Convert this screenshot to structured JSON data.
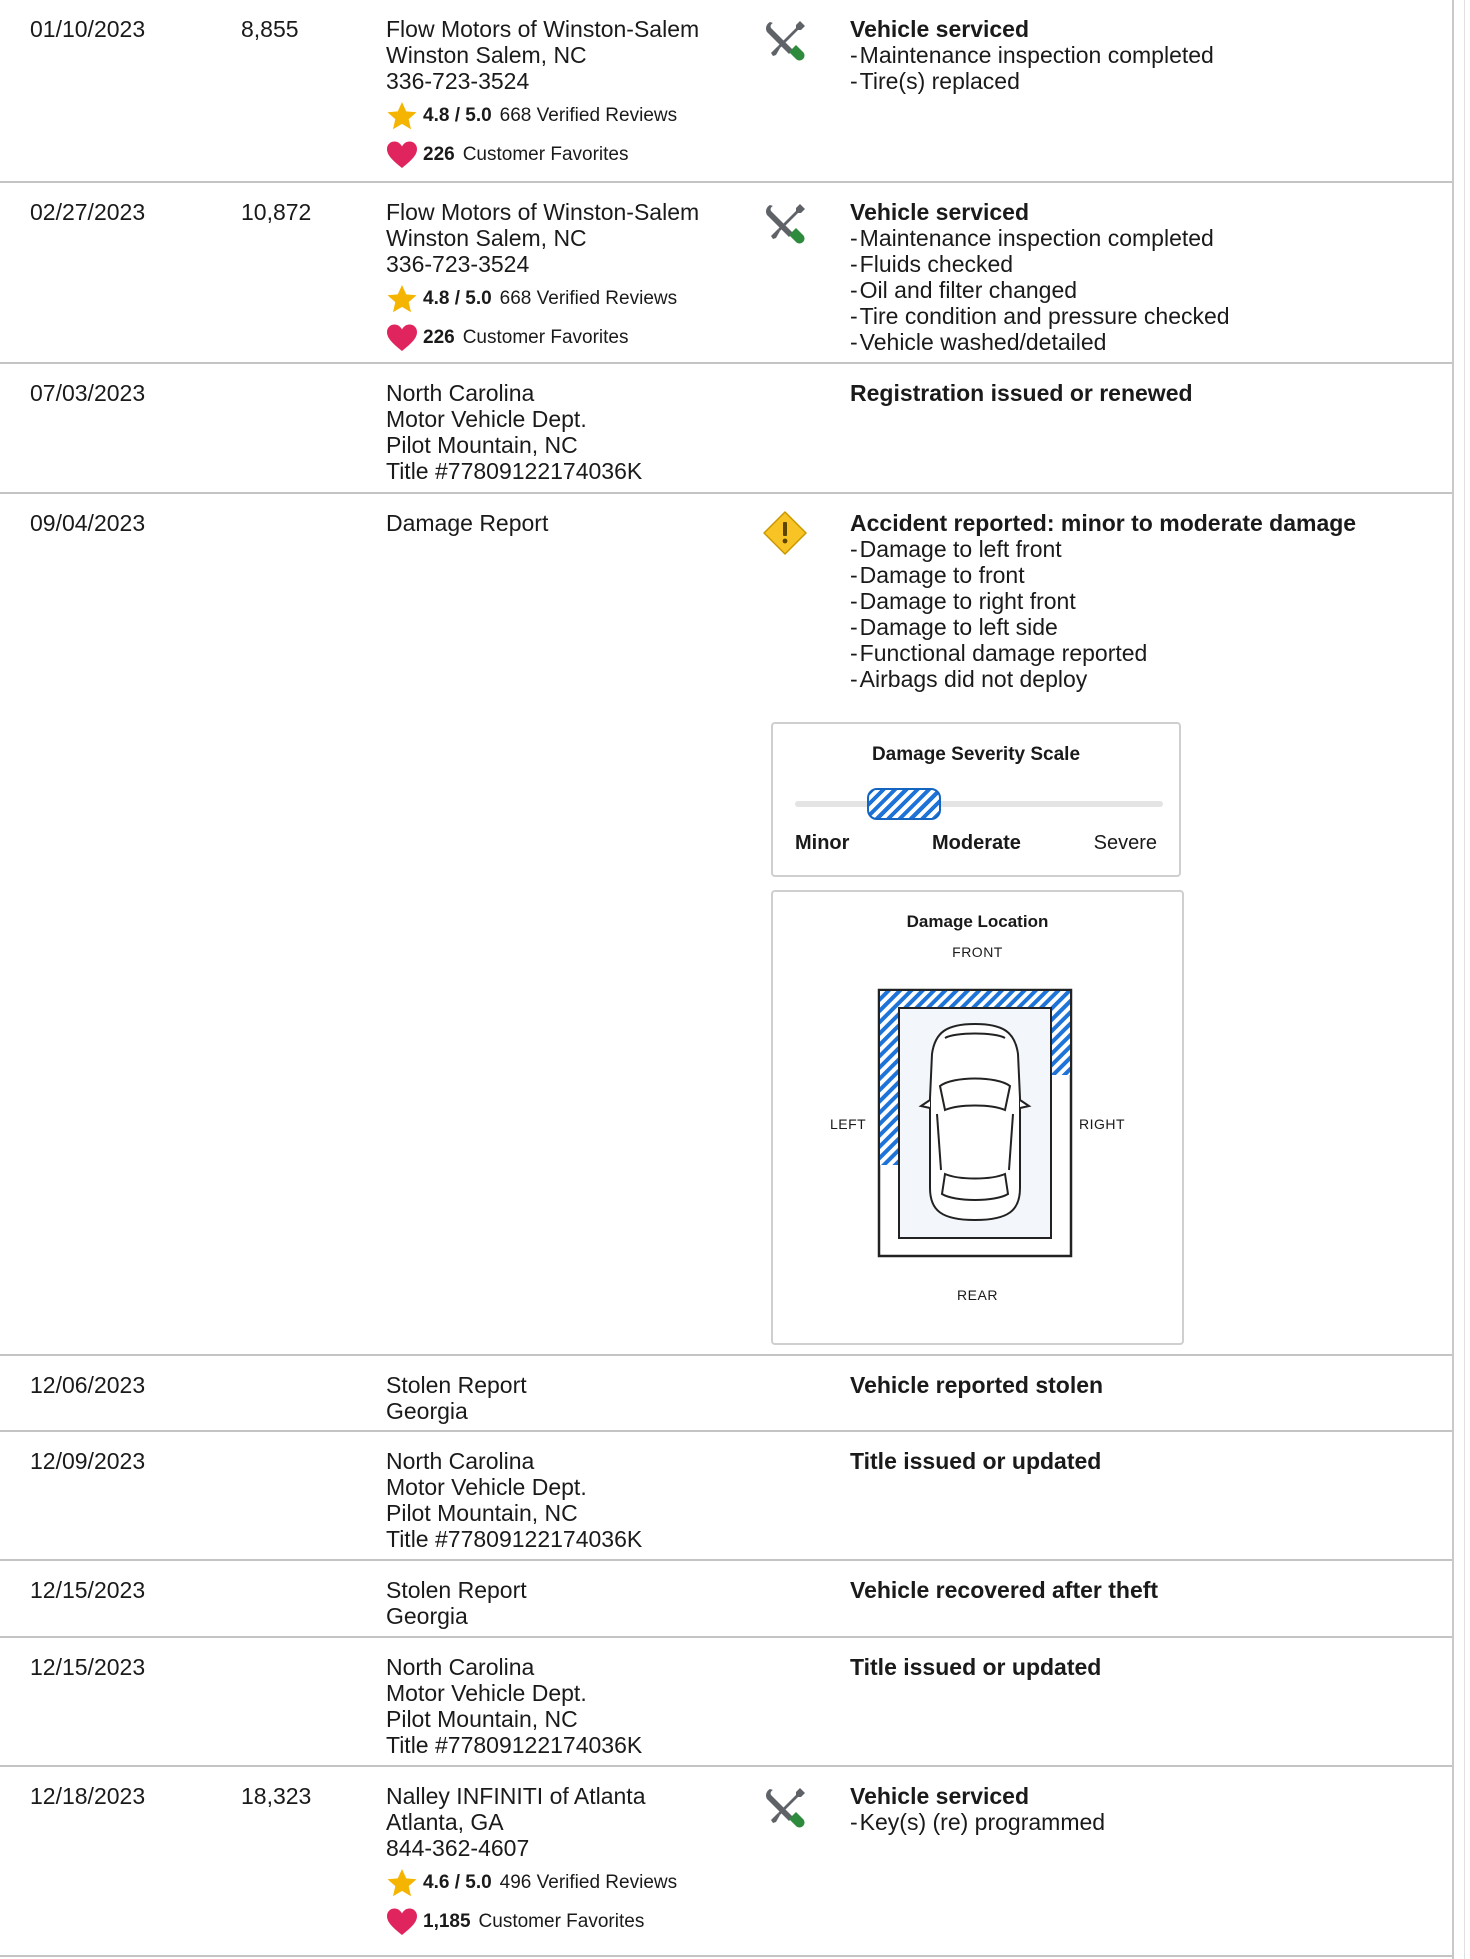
{
  "records": [
    {
      "date": "01/10/2023",
      "odometer": "8,855",
      "source": [
        "Flow Motors of Winston-Salem",
        "Winston Salem, NC",
        "336-723-3524"
      ],
      "rating": {
        "score": "4.8 / 5.0",
        "reviews": "668 Verified Reviews",
        "favorites_count": "226",
        "favorites_label": "Customer Favorites"
      },
      "icon": "wrench-screwdriver-icon",
      "title": "Vehicle serviced",
      "items": [
        "Maintenance inspection completed",
        "Tire(s) replaced"
      ]
    },
    {
      "date": "02/27/2023",
      "odometer": "10,872",
      "source": [
        "Flow Motors of Winston-Salem",
        "Winston Salem, NC",
        "336-723-3524"
      ],
      "rating": {
        "score": "4.8 / 5.0",
        "reviews": "668 Verified Reviews",
        "favorites_count": "226",
        "favorites_label": "Customer Favorites"
      },
      "icon": "wrench-screwdriver-icon",
      "title": "Vehicle serviced",
      "items": [
        "Maintenance inspection completed",
        "Fluids checked",
        "Oil and filter changed",
        "Tire condition and pressure checked",
        "Vehicle washed/detailed"
      ]
    },
    {
      "date": "07/03/2023",
      "odometer": "",
      "source": [
        "North Carolina",
        "Motor Vehicle Dept.",
        "Pilot Mountain, NC",
        "Title #77809122174036K"
      ],
      "icon": "",
      "title": "Registration issued or renewed",
      "items": []
    },
    {
      "date": "09/04/2023",
      "odometer": "",
      "source": [
        "Damage Report"
      ],
      "icon": "warning-diamond-icon",
      "title": "Accident reported: minor to moderate damage",
      "items": [
        "Damage to left front",
        "Damage to front",
        "Damage to right front",
        "Damage to left side",
        "Functional damage reported",
        "Airbags did not deploy"
      ]
    },
    {
      "date": "12/06/2023",
      "odometer": "",
      "source": [
        "Stolen Report",
        "Georgia"
      ],
      "icon": "",
      "title": "Vehicle reported stolen",
      "items": []
    },
    {
      "date": "12/09/2023",
      "odometer": "",
      "source": [
        "North Carolina",
        "Motor Vehicle Dept.",
        "Pilot Mountain, NC",
        "Title #77809122174036K"
      ],
      "icon": "",
      "title": "Title issued or updated",
      "items": []
    },
    {
      "date": "12/15/2023",
      "odometer": "",
      "source": [
        "Stolen Report",
        "Georgia"
      ],
      "icon": "",
      "title": "Vehicle recovered after theft",
      "items": []
    },
    {
      "date": "12/15/2023",
      "odometer": "",
      "source": [
        "North Carolina",
        "Motor Vehicle Dept.",
        "Pilot Mountain, NC",
        "Title #77809122174036K"
      ],
      "icon": "",
      "title": "Title issued or updated",
      "items": []
    },
    {
      "date": "12/18/2023",
      "odometer": "18,323",
      "source": [
        "Nalley INFINITI of Atlanta",
        "Atlanta, GA",
        "844-362-4607"
      ],
      "rating": {
        "score": "4.6 / 5.0",
        "reviews": "496 Verified Reviews",
        "favorites_count": "1,185",
        "favorites_label": "Customer Favorites"
      },
      "icon": "wrench-screwdriver-icon",
      "title": "Vehicle serviced",
      "items": [
        "Key(s) (re) programmed"
      ]
    }
  ],
  "severity_scale": {
    "title": "Damage Severity Scale",
    "labels": [
      "Minor",
      "Moderate",
      "Severe"
    ],
    "highlighted": "Minor to Moderate"
  },
  "damage_location": {
    "title": "Damage Location",
    "front": "FRONT",
    "rear": "REAR",
    "left": "LEFT",
    "right": "RIGHT",
    "damaged_areas": [
      "left-front",
      "front",
      "right-front",
      "left-side"
    ]
  },
  "colors": {
    "star": "#f4b400",
    "heart": "#e0245e",
    "damage_blue": "#1e73d8",
    "warning": "#f7c325",
    "wrench_green": "#2e8b3d"
  }
}
